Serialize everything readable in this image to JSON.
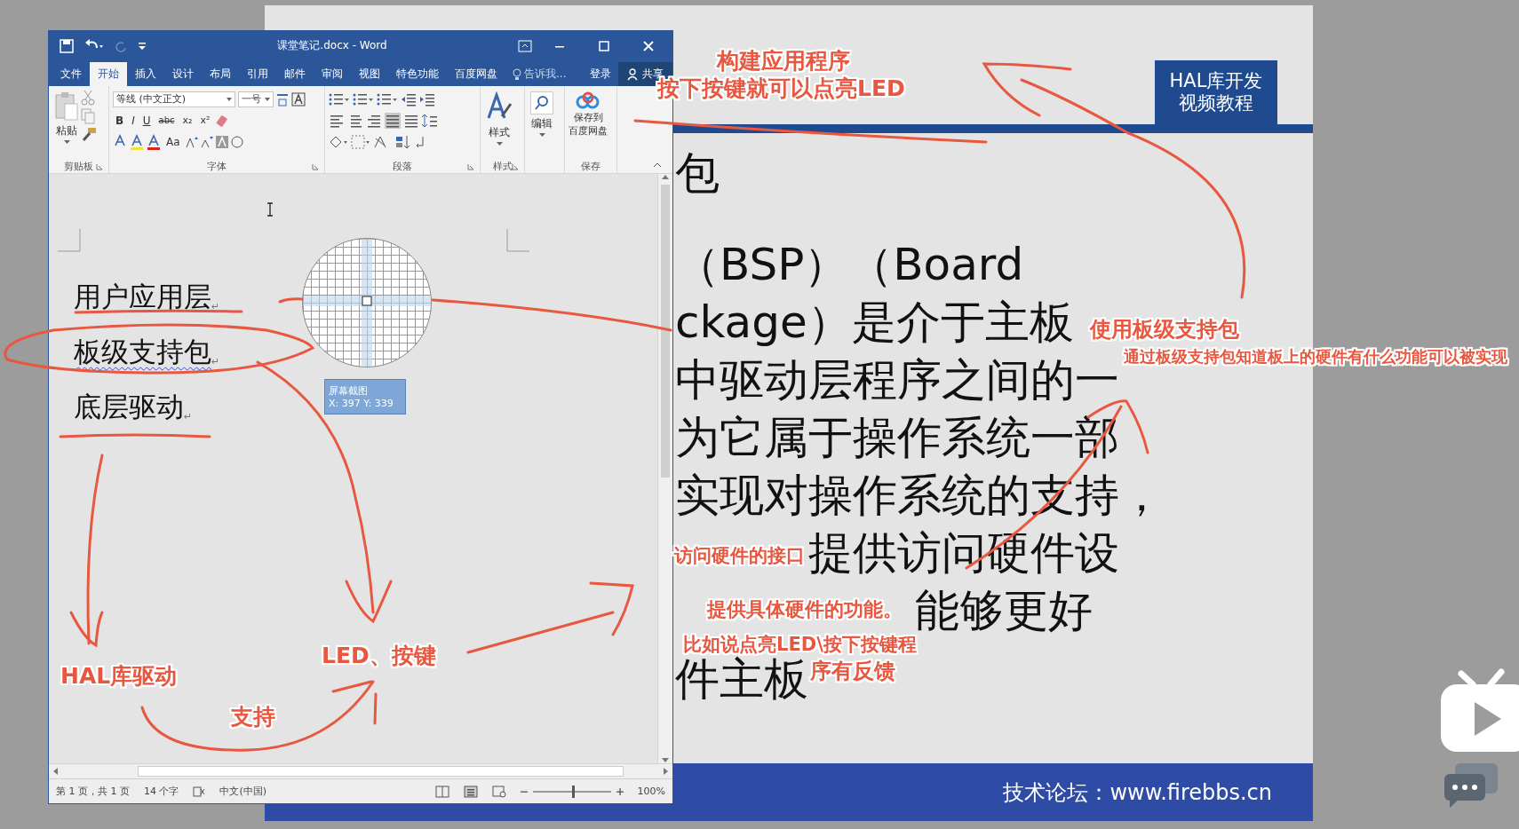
{
  "word_window": {
    "title": "课堂笔记.docx - Word",
    "tabs": [
      {
        "label": "文件",
        "selected": false
      },
      {
        "label": "开始",
        "selected": true
      },
      {
        "label": "插入",
        "selected": false
      },
      {
        "label": "设计",
        "selected": false
      },
      {
        "label": "布局",
        "selected": false
      },
      {
        "label": "引用",
        "selected": false
      },
      {
        "label": "邮件",
        "selected": false
      },
      {
        "label": "审阅",
        "selected": false
      },
      {
        "label": "视图",
        "selected": false
      },
      {
        "label": "特色功能",
        "selected": false
      },
      {
        "label": "百度网盘",
        "selected": false
      }
    ],
    "tell_me": "告诉我...",
    "sign_in": "登录",
    "share": "共享",
    "ribbon": {
      "paste": "粘贴",
      "font_name": "等线 (中文正文)",
      "font_size": "一号",
      "format_buttons": [
        "B",
        "I",
        "U",
        "abc",
        "x₂",
        "x²"
      ],
      "change_case": "Aa",
      "alignment_buttons": [
        {
          "selected": false
        },
        {
          "selected": false
        },
        {
          "selected": false
        },
        {
          "selected": true
        },
        {
          "selected": false
        }
      ],
      "styles": "样式",
      "editing": "编辑",
      "save_to_cloud": [
        "保存到",
        "百度网盘"
      ],
      "group_labels": [
        "剪贴板",
        "字体",
        "段落",
        "样式",
        "保存"
      ]
    },
    "document": {
      "lines": [
        {
          "text": "用户应用层",
          "mark": "↵",
          "misspelled": false
        },
        {
          "text": "板级支持包",
          "mark": "↵",
          "misspelled": true
        },
        {
          "text": "底层驱动",
          "mark": "↵",
          "misspelled": false
        }
      ],
      "magnifier_tooltip": {
        "title": "屏幕截图",
        "coords": "X: 397 Y: 339"
      }
    },
    "status_bar": {
      "page": "第 1 页，共 1 页",
      "words": "14 个字",
      "language": "中文(中国)",
      "zoom": "100%",
      "zoom_slider": {
        "level": 0.5
      }
    }
  },
  "slide": {
    "badge": [
      "HAL库开发",
      "视频教程"
    ],
    "lines": [
      "包",
      "（BSP）（Board",
      "ckage）是介于主板",
      "中驱动层程序之间的一",
      "为它属于操作系统一部",
      "实现对操作系统的支持，",
      "提供访问硬件设",
      "能够更好",
      "件主板"
    ],
    "footer": "技术论坛：www.firebbs.cn"
  },
  "annotations": [
    "构建应用程序",
    "按下按键就可以点亮LED",
    "使用板级支持包",
    "通过板级支持包知道板上的硬件有什么功能可以被实现",
    "访问硬件的接口",
    "提供具体硬件的功能。",
    "比如说点亮LED\\按下按键程",
    "序有反馈",
    "LED、按键",
    "HAL库驱动",
    "支持"
  ]
}
